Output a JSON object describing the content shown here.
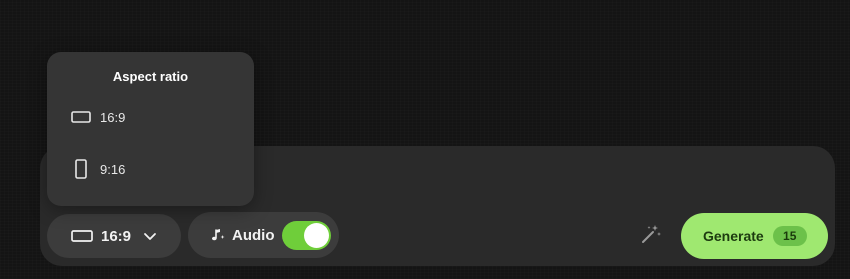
{
  "aspect_ratio_menu": {
    "title": "Aspect ratio",
    "options": [
      {
        "label": "16:9",
        "icon": "landscape-rect-icon"
      },
      {
        "label": "9:16",
        "icon": "portrait-rect-icon"
      }
    ]
  },
  "toolbar": {
    "aspect_ratio": {
      "selected_label": "16:9",
      "icon": "landscape-rect-icon",
      "chevron": "chevron-down-icon"
    },
    "audio": {
      "label": "Audio",
      "icon": "music-note-sparkle-icon",
      "enabled": true
    },
    "enhance": {
      "icon": "magic-wand-icon"
    },
    "generate": {
      "label": "Generate",
      "credits": "15"
    }
  },
  "colors": {
    "background": "#141414",
    "panel": "#2a2a2a",
    "popover": "#353535",
    "pill": "#3c3c3c",
    "toggle_on": "#6fce3a",
    "generate_bg": "#9fe870",
    "generate_text": "#1d3b10",
    "badge_bg": "#6cc14a"
  }
}
